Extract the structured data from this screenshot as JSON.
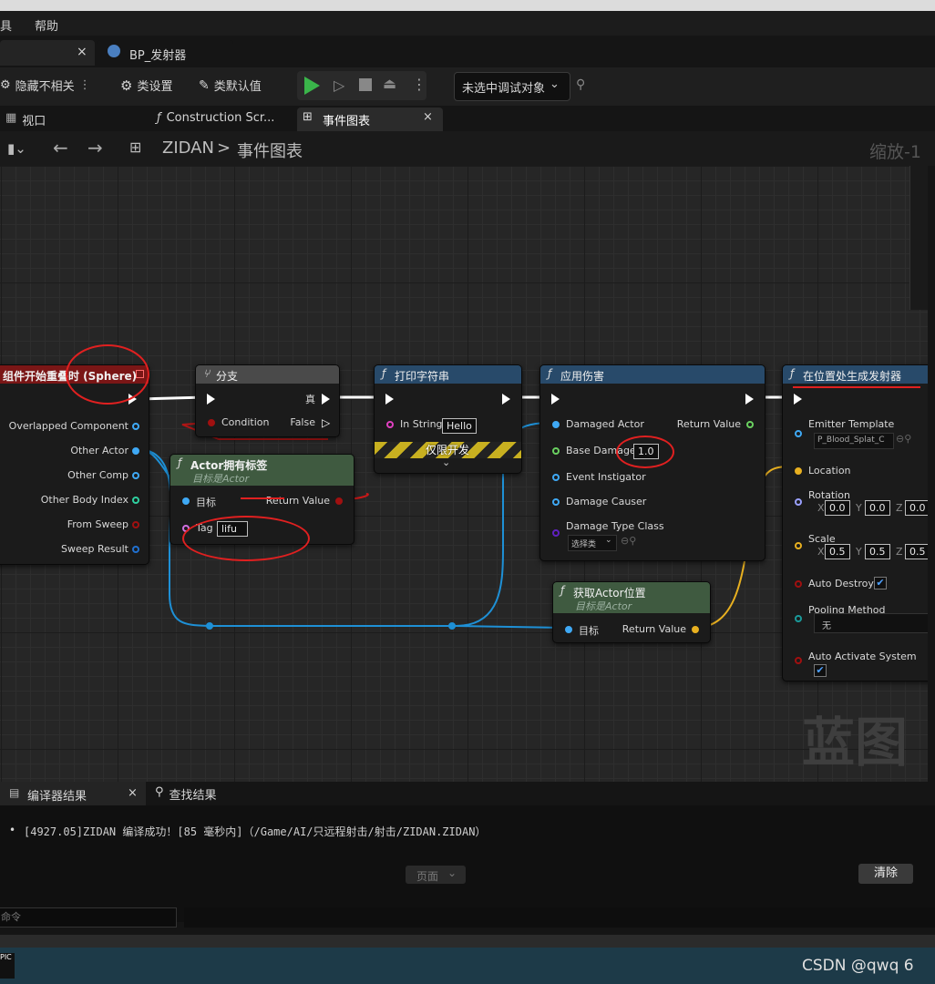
{
  "menu": {
    "tools": "具",
    "help": "帮助"
  },
  "doc_tabs": {
    "close": "×",
    "bp": "BP_发射器"
  },
  "toolbar": {
    "hide": "隐藏不相关",
    "class_settings": "类设置",
    "class_defaults": "类默认值",
    "debug_target": "未选中调试对象"
  },
  "sub_tabs": {
    "viewport": "视口",
    "construction": "Construction Scr...",
    "event_graph": "事件图表",
    "close": "×"
  },
  "breadcrumb": {
    "blueprint": "ZIDAN",
    "sep": ">",
    "graph": "事件图表",
    "zoom": "缩放-1"
  },
  "nodes": {
    "overlap": {
      "title": "组件开始重叠时 (Sphere)",
      "pins": [
        "Overlapped Component",
        "Other Actor",
        "Other Comp",
        "Other Body Index",
        "From Sweep",
        "Sweep Result"
      ]
    },
    "branch": {
      "title": "分支",
      "true": "真",
      "condition": "Condition",
      "false": "False"
    },
    "print": {
      "title": "打印字符串",
      "in_string": "In String",
      "value": "Hello",
      "dev_only": "仅限开发"
    },
    "has_tag": {
      "title": "Actor拥有标签",
      "subtitle": "目标是Actor",
      "target": "目标",
      "return": "Return Value",
      "tag": "Tag",
      "tag_value": "lifu"
    },
    "damage": {
      "title": "应用伤害",
      "damaged_actor": "Damaged Actor",
      "return": "Return Value",
      "base_damage": "Base Damage",
      "base_value": "1.0",
      "instigator": "Event Instigator",
      "causer": "Damage Causer",
      "type_class": "Damage Type Class",
      "select": "选择类"
    },
    "get_loc": {
      "title": "获取Actor位置",
      "subtitle": "目标是Actor",
      "target": "目标",
      "return": "Return Value"
    },
    "spawn": {
      "title": "在位置处生成发射器",
      "template": "Emitter Template",
      "template_value": "P_Blood_Splat_C",
      "location": "Location",
      "rotation": "Rotation",
      "scale": "Scale",
      "x": "X",
      "y": "Y",
      "z": "Z",
      "rot_vals": [
        "0.0",
        "0.0",
        "0.0"
      ],
      "scale_vals": [
        "0.5",
        "0.5",
        "0.5"
      ],
      "auto_destroy": "Auto Destroy",
      "pooling": "Pooling Method",
      "pooling_value": "无",
      "auto_activate": "Auto Activate System"
    }
  },
  "watermark": "蓝图",
  "bottom": {
    "compiler_tab": "编译器结果",
    "close": "×",
    "find_tab": "查找结果",
    "log": "[4927.05]ZIDAN 编译成功！[85 毫秒内]（/Game/AI/只远程射击/射击/ZIDAN.ZIDAN）",
    "page": "页面",
    "clear": "清除",
    "cmd_placeholder": "命令"
  },
  "taskbar": {
    "csdn": "CSDN @qwq 6"
  }
}
